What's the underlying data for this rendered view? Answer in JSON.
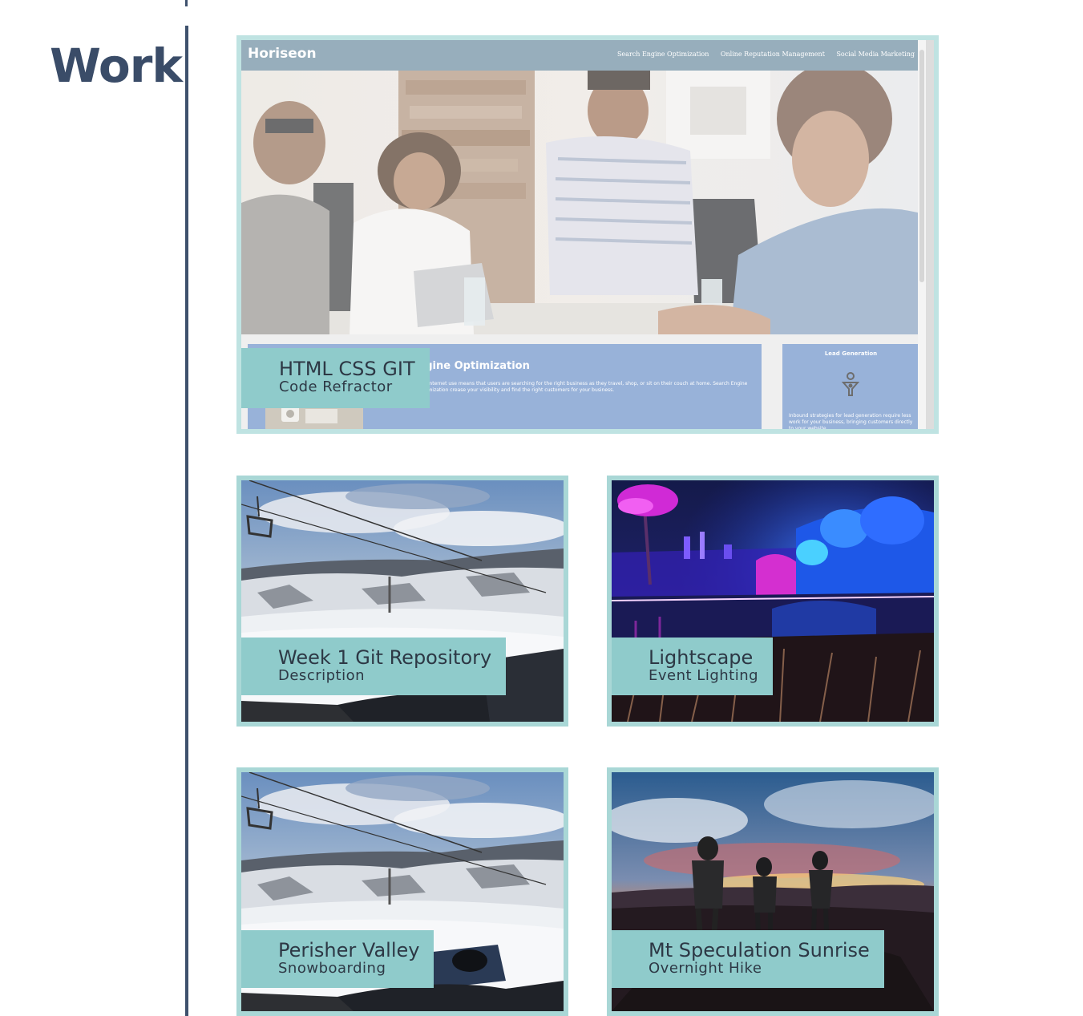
{
  "section": {
    "title": "Work"
  },
  "featured": {
    "caption_title": "HTML CSS GIT",
    "caption_subtitle": "Code Refractor",
    "site": {
      "logo": "Horiseon",
      "nav": [
        "Search Engine Optimization",
        "Online Reputation Management",
        "Social Media Marketing"
      ],
      "content_title": "ngine Optimization",
      "content_text": "bile internet use means that users are searching for the right business as they travel, shop, or sit on their couch at home. Search Engine Optimization crease your visibility and find the right customers for your business.",
      "aside_title": "Lead Generation",
      "aside_text": "Inbound strategies for lead generation require less work for your business, bringing customers directly to your website."
    }
  },
  "projects": [
    {
      "id": "ski1",
      "title": "Week 1 Git Repository",
      "subtitle": "Description",
      "image": "snowy-ski-slope-with-chairlift"
    },
    {
      "id": "light",
      "title": "Lightscape",
      "subtitle": "Event Lighting",
      "image": "illuminated-palm-trees-at-night"
    },
    {
      "id": "ski2",
      "title": "Perisher Valley",
      "subtitle": "Snowboarding",
      "image": "snowy-ski-slope-with-chairlift"
    },
    {
      "id": "hike",
      "title": "Mt Speculation Sunrise",
      "subtitle": "Overnight Hike",
      "image": "hikers-silhouetted-at-sunrise"
    }
  ],
  "colors": {
    "accent": "#8fcbcb",
    "border": "#a9d7d6",
    "heading": "#3a4c68",
    "divider": "#3e516d",
    "site_header": "#97aebc",
    "site_panel": "#98b2d9"
  }
}
